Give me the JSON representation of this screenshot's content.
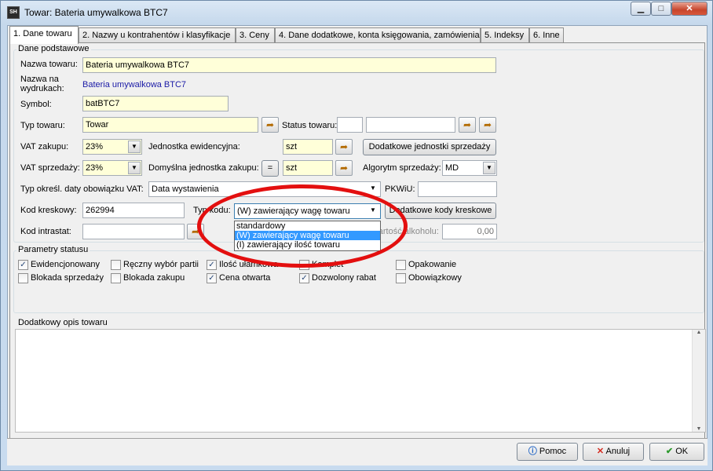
{
  "window": {
    "title": "Towar: Bateria umywalkowa BTC7",
    "app_icon_text": "SH"
  },
  "tabs": [
    {
      "label": "1. Dane towaru"
    },
    {
      "label": "2. Nazwy u kontrahentów i klasyfikacje"
    },
    {
      "label": "3. Ceny"
    },
    {
      "label": "4. Dane dodatkowe, konta księgowania, zamówienia"
    },
    {
      "label": "5. Indeksy"
    },
    {
      "label": "6. Inne"
    }
  ],
  "basic": {
    "group_label": "Dane podstawowe",
    "name_label": "Nazwa towaru:",
    "name_value": "Bateria umywalkowa BTC7",
    "print_name_label": "Nazwa na wydrukach:",
    "print_name_value": "Bateria umywalkowa BTC7",
    "symbol_label": "Symbol:",
    "symbol_value": "batBTC7",
    "type_label": "Typ towaru:",
    "type_value": "Towar",
    "status_label": "Status towaru:",
    "status_value": "",
    "status_value2": "",
    "vat_purchase_label": "VAT zakupu:",
    "vat_purchase_value": "23%",
    "unit_label": "Jednostka ewidencyjna:",
    "unit_value": "szt",
    "extra_units_button": "Dodatkowe jednostki sprzedaży",
    "vat_sale_label": "VAT sprzedaży:",
    "vat_sale_value": "23%",
    "default_unit_label": "Domyślna jednostka zakupu:",
    "default_unit_eq": "=",
    "default_unit_value": "szt",
    "algorithm_label": "Algorytm sprzedaży:",
    "algorithm_value": "MD",
    "vat_date_label": "Typ określ. daty obowiązku VAT:",
    "vat_date_value": "Data wystawienia",
    "pkwiu_label": "PKWiU:",
    "pkwiu_value": "",
    "barcode_label": "Kod kreskowy:",
    "barcode_value": "262994",
    "code_type_label": "Typ kodu:",
    "code_type_value": "(W) zawierający wagę towaru",
    "extra_barcodes_button": "Dodatkowe kody kreskowe",
    "intrastat_label": "Kod intrastat:",
    "intrastat_value": "",
    "alcohol_label": "Zawartość alkoholu:",
    "alcohol_value": "0,00",
    "dropdown_options": [
      {
        "label": "standardowy",
        "selected": false
      },
      {
        "label": "(W) zawierający wagę towaru",
        "selected": true
      },
      {
        "label": "(I) zawierający ilość towaru",
        "selected": false
      }
    ]
  },
  "status": {
    "group_label": "Parametry statusu",
    "checkboxes": [
      {
        "label": "Ewidencjonowany",
        "checked": true
      },
      {
        "label": "Ręczny wybór partii",
        "checked": false
      },
      {
        "label": "Ilość ułamkowa",
        "checked": true
      },
      {
        "label": "Komplet",
        "checked": false
      },
      {
        "label": "Opakowanie",
        "checked": false
      },
      {
        "label": "Blokada sprzedaży",
        "checked": false
      },
      {
        "label": "Blokada zakupu",
        "checked": false
      },
      {
        "label": "Cena otwarta",
        "checked": true
      },
      {
        "label": "Dozwolony rabat",
        "checked": true
      },
      {
        "label": "Obowiązkowy",
        "checked": false
      }
    ]
  },
  "description": {
    "group_label": "Dodatkowy opis towaru",
    "value": ""
  },
  "footer": {
    "help_label": "Pomoc",
    "cancel_label": "Anuluj",
    "ok_label": "OK"
  },
  "colors": {
    "highlight_ring": "#e30f0f",
    "field_bg": "#ffffd9",
    "selection": "#3399ff"
  }
}
